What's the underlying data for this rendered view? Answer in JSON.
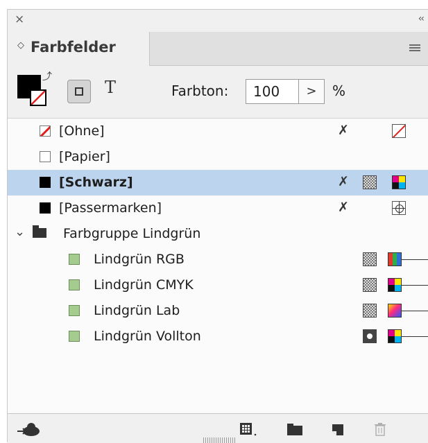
{
  "panel": {
    "close_glyph": "×",
    "collapse_glyph": "‹‹",
    "tab": {
      "arrows_glyph": "◇",
      "label": "Farbfelder"
    }
  },
  "toolbar": {
    "text_glyph": "T",
    "tint_label": "Farbton:",
    "tint_value": "100",
    "tint_arrow": ">",
    "percent": "%"
  },
  "swatches": [
    {
      "name": "[Ohne]",
      "swatch": "none",
      "icons": [
        "not-editable",
        "none-mode"
      ],
      "selected": false
    },
    {
      "name": "[Papier]",
      "swatch": "white",
      "icons": [],
      "selected": false
    },
    {
      "name": "[Schwarz]",
      "swatch": "black",
      "icons": [
        "not-editable",
        "process",
        "cmyk"
      ],
      "selected": true
    },
    {
      "name": "[Passermarken]",
      "swatch": "black",
      "icons": [
        "not-editable",
        "registration"
      ],
      "selected": false
    }
  ],
  "group": {
    "name": "Farbgruppe Lindgrün",
    "items": [
      {
        "name": "Lindgrün RGB",
        "swatch": "green",
        "type": "process",
        "mode": "rgb"
      },
      {
        "name": "Lindgrün CMYK",
        "swatch": "green",
        "type": "process",
        "mode": "cmyk"
      },
      {
        "name": "Lindgrün Lab",
        "swatch": "green",
        "type": "process",
        "mode": "lab"
      },
      {
        "name": "Lindgrün Vollton",
        "swatch": "green",
        "type": "spot",
        "mode": "cmyk"
      }
    ]
  },
  "colors": {
    "selection": "#bcd4ed",
    "green_swatch": "#a4cc8e",
    "none_red": "#e0201c"
  }
}
